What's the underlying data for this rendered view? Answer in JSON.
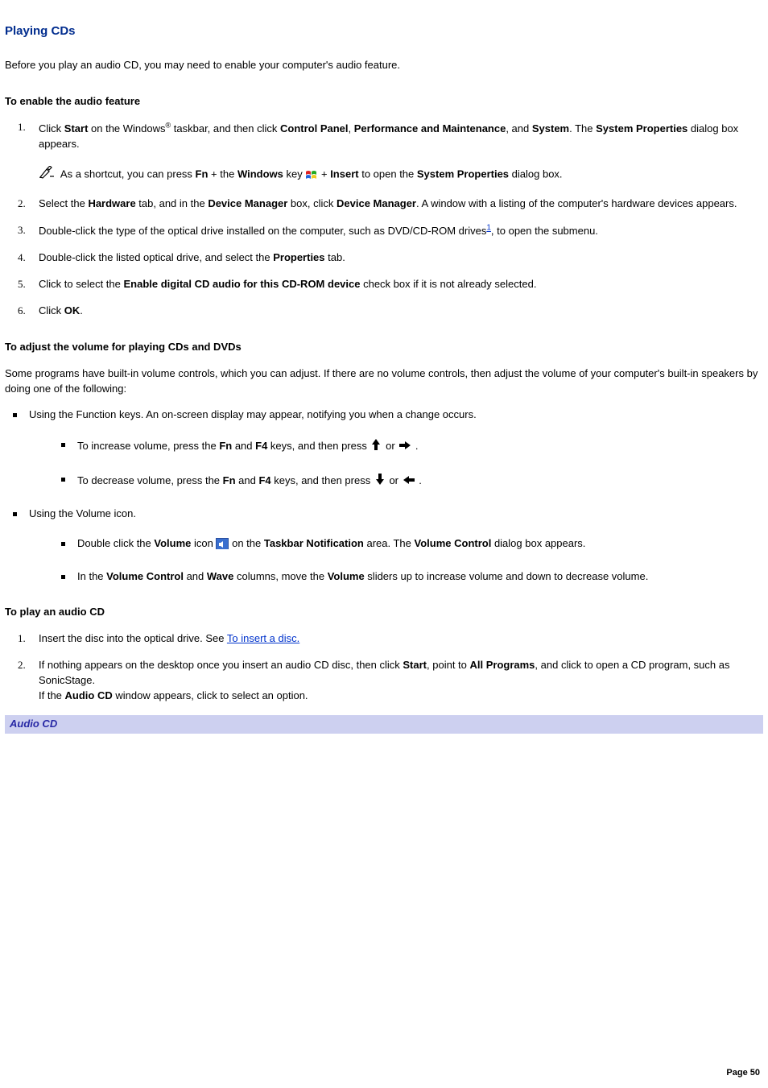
{
  "title": "Playing CDs",
  "intro": "Before you play an audio CD, you may need to enable your computer's audio feature.",
  "sections": {
    "enable_audio": {
      "heading": "To enable the audio feature",
      "steps": {
        "s1": {
          "pre": "Click ",
          "b1": "Start",
          "mid1": " on the Windows",
          "reg": "®",
          "mid2": " taskbar, and then click ",
          "b2": "Control Panel",
          "sep1": ", ",
          "b3": "Performance and Maintenance",
          "sep2": ", and ",
          "b4": "System",
          "post": ". The ",
          "b5": "System Properties",
          "tail": " dialog box appears."
        },
        "note": {
          "pre": "As a shortcut, you can press ",
          "b1": "Fn",
          "mid1": " + the ",
          "b2": "Windows",
          "mid2": " key ",
          "mid3": " + ",
          "b3": "Insert",
          "mid4": " to open the ",
          "b4": "System Properties",
          "tail": " dialog box."
        },
        "s2": {
          "pre": "Select the ",
          "b1": "Hardware",
          "mid1": " tab, and in the ",
          "b2": "Device Manager",
          "mid2": " box, click ",
          "b3": "Device Manager",
          "tail": ". A window with a listing of the computer's hardware devices appears."
        },
        "s3": {
          "pre": "Double-click the type of the optical drive installed on the computer, such as DVD/CD-ROM drives",
          "fn": "1",
          "tail": ", to open the submenu."
        },
        "s4": {
          "pre": "Double-click the listed optical drive, and select the ",
          "b1": "Properties",
          "tail": " tab."
        },
        "s5": {
          "pre": "Click to select the ",
          "b1": "Enable digital CD audio for this CD-ROM device",
          "tail": " check box if it is not already selected."
        },
        "s6": {
          "pre": "Click ",
          "b1": "OK",
          "tail": "."
        }
      }
    },
    "adjust_volume": {
      "heading": "To adjust the volume for playing CDs and DVDs",
      "intro": "Some programs have built-in volume controls, which you can adjust. If there are no volume controls, then adjust the volume of your computer's built-in speakers by doing one of the following:",
      "b1": {
        "text": "Using the Function keys. An on-screen display may appear, notifying you when a change occurs.",
        "sub_inc": {
          "pre": "To increase volume, press the ",
          "b1": "Fn",
          "mid1": " and ",
          "b2": "F4",
          "mid2": " keys, and then press ",
          "or": " or ",
          "tail": " ."
        },
        "sub_dec": {
          "pre": "To decrease volume, press the ",
          "b1": "Fn",
          "mid1": " and ",
          "b2": "F4",
          "mid2": " keys, and then press ",
          "or": " or ",
          "tail": " ."
        }
      },
      "b2": {
        "text": "Using the Volume icon.",
        "sub_dbl": {
          "pre": "Double click the ",
          "b1": "Volume",
          "mid1": " icon ",
          "mid2": " on the ",
          "b2": "Taskbar Notification",
          "mid3": " area. The ",
          "b3": "Volume Control",
          "tail": " dialog box appears."
        },
        "sub_slide": {
          "pre": "In the ",
          "b1": "Volume Control",
          "mid1": " and ",
          "b2": "Wave",
          "mid2": " columns, move the ",
          "b3": "Volume",
          "tail": " sliders up to increase volume and down to decrease volume."
        }
      }
    },
    "play_cd": {
      "heading": "To play an audio CD",
      "s1": {
        "pre": "Insert the disc into the optical drive. See ",
        "link": "To insert a disc."
      },
      "s2": {
        "pre": "If nothing appears on the desktop once you insert an audio CD disc, then click ",
        "b1": "Start",
        "mid1": ", point to ",
        "b2": "All Programs",
        "mid2": ", and click to open a CD program, such as SonicStage.",
        "line2_pre": "If the ",
        "b3": "Audio CD",
        "line2_tail": " window appears, click to select an option."
      },
      "caption": "Audio CD"
    }
  },
  "page_label": "Page 50"
}
